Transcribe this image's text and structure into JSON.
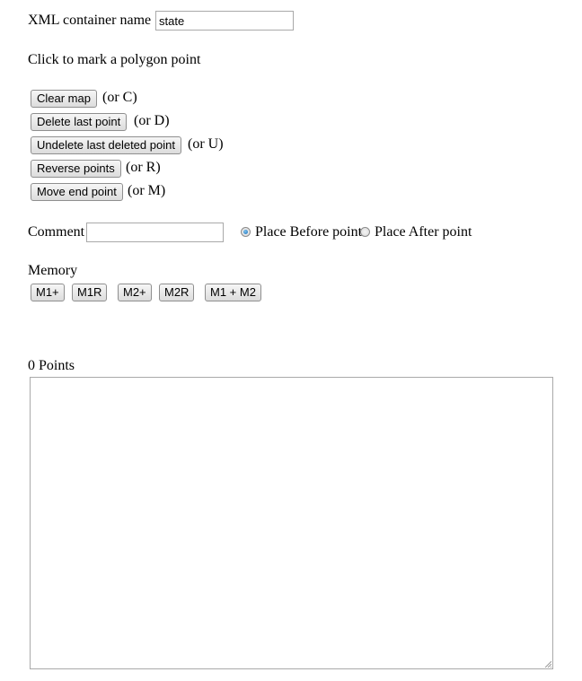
{
  "container": {
    "label": "XML container name",
    "value": "state"
  },
  "instruction": "Click to mark a polygon point",
  "actions": [
    {
      "label": "Clear map",
      "hint": "(or C)"
    },
    {
      "label": "Delete last point",
      "hint": "(or D)"
    },
    {
      "label": "Undelete last deleted point",
      "hint": "(or U)"
    },
    {
      "label": "Reverse points",
      "hint": "(or R)"
    },
    {
      "label": "Move end point",
      "hint": "(or M)"
    }
  ],
  "comment": {
    "label": "Comment",
    "value": "",
    "placement_options": [
      {
        "label": "Place Before point",
        "checked": true
      },
      {
        "label": "Place After point",
        "checked": false
      }
    ]
  },
  "memory": {
    "label": "Memory",
    "buttons": [
      "M1+",
      "M1R",
      "M2+",
      "M2R",
      "M1 + M2"
    ]
  },
  "points": {
    "count_label": "0 Points",
    "text": ""
  }
}
